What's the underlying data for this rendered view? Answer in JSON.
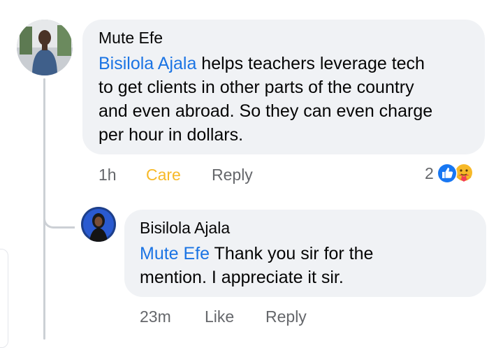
{
  "comment": {
    "author": "Mute Efe",
    "mention": "Bisilola Ajala",
    "text_lines": [
      " helps teachers leverage tech",
      "to get clients in other parts of the country",
      "and even abroad. So they can even charge",
      "per hour in dollars."
    ],
    "time": "1h",
    "reaction_label": "Care",
    "reply_label": "Reply",
    "reaction_count": "2",
    "reaction_icons": [
      "like-icon",
      "care-icon"
    ],
    "reaction_label_color": "#f7b928"
  },
  "reply": {
    "author": "Bisilola Ajala",
    "mention": "Mute Efe",
    "text_lines": [
      " Thank you sir for the",
      "mention. I appreciate it sir."
    ],
    "time": "23m",
    "like_label": "Like",
    "reply_label": "Reply"
  },
  "colors": {
    "mention": "#1b74e4",
    "bubble": "#f0f2f5",
    "meta": "#65676b"
  }
}
